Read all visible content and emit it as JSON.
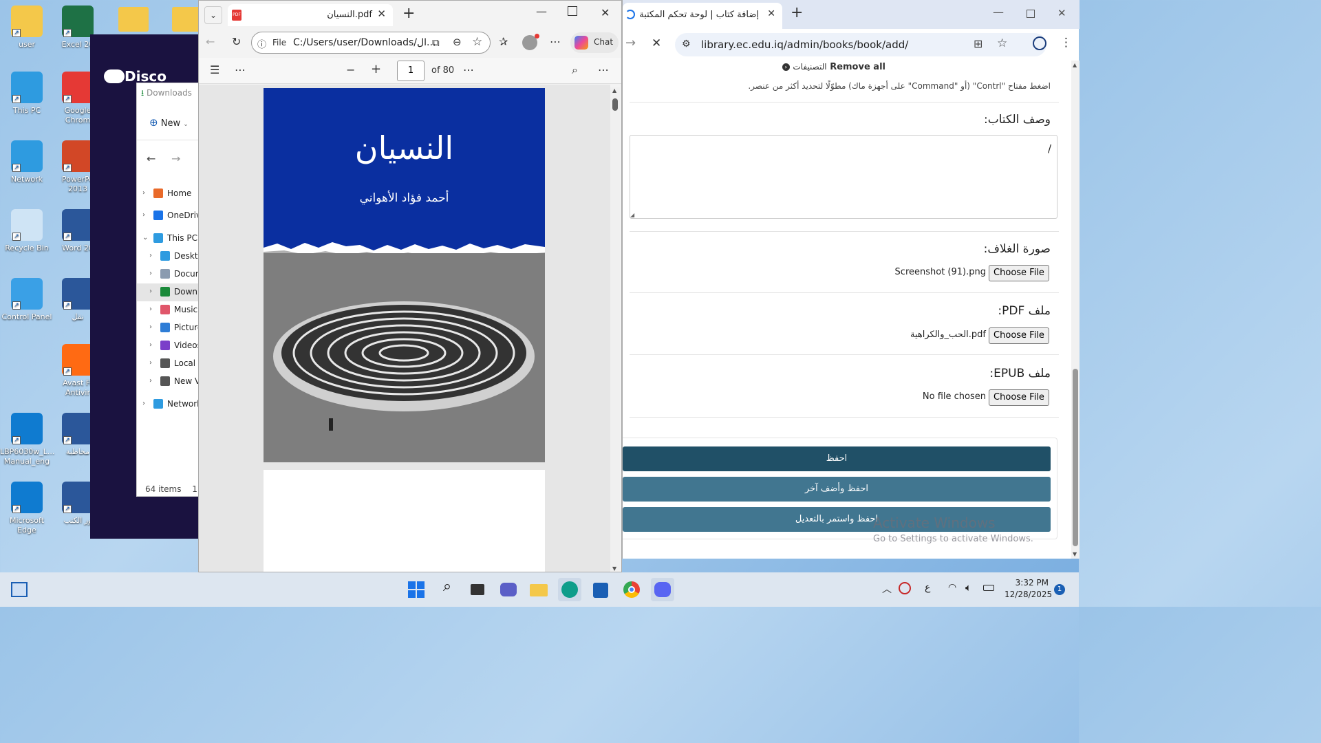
{
  "desktop": {
    "icons_left": [
      {
        "label": "user",
        "color": "#f4c84a"
      },
      {
        "label": "This PC",
        "color": "#2e9be0"
      },
      {
        "label": "Network",
        "color": "#2e9be0"
      },
      {
        "label": "Recycle Bin",
        "color": "#cfe4f5"
      },
      {
        "label": "Control Panel",
        "color": "#3aa0e6"
      },
      {
        "label": "LBP6030w_L...\nManual_eng",
        "color": "#0f7bd0"
      },
      {
        "label": "Microsoft\nEdge",
        "color": "#0f7bd0"
      }
    ],
    "icons_right": [
      {
        "label": "Excel 20",
        "color": "#1e7145"
      },
      {
        "label": "Google\nChrom",
        "color": "#e53935"
      },
      {
        "label": "PowerPo\n2013",
        "color": "#d24726"
      },
      {
        "label": "Word 20",
        "color": "#2b579a"
      },
      {
        "label": "نقل",
        "color": "#2b579a"
      },
      {
        "label": "Avast Fr\nAntivir",
        "color": "#ff6a13"
      },
      {
        "label": "مخاطبة",
        "color": "#2b579a"
      },
      {
        "label": "ور الكتب",
        "color": "#2b579a"
      }
    ],
    "folder_icons": [
      "folder",
      "folder"
    ]
  },
  "discord": {
    "logo_text": "Disco"
  },
  "explorer": {
    "breadcrumb": "Downloads",
    "new_label": "New",
    "nav": [
      {
        "label": "Home",
        "indent": 0,
        "expanded": false,
        "icon_color": "#e96a2a"
      },
      {
        "label": "OneDriv",
        "indent": 0,
        "expanded": false,
        "icon_color": "#1a73e8"
      },
      {
        "label": "This PC",
        "indent": 0,
        "expanded": true,
        "icon_color": "#2e9be0"
      },
      {
        "label": "Deskto",
        "indent": 1,
        "expanded": false,
        "icon_color": "#2e9be0"
      },
      {
        "label": "Docum",
        "indent": 1,
        "expanded": false,
        "icon_color": "#8a9bb0"
      },
      {
        "label": "Downl",
        "indent": 1,
        "expanded": false,
        "icon_color": "#1b8a3a",
        "selected": true
      },
      {
        "label": "Music",
        "indent": 1,
        "expanded": false,
        "icon_color": "#e0566a"
      },
      {
        "label": "Picture",
        "indent": 1,
        "expanded": false,
        "icon_color": "#2e7dd6"
      },
      {
        "label": "Videos",
        "indent": 1,
        "expanded": false,
        "icon_color": "#7b3fc9"
      },
      {
        "label": "Local D",
        "indent": 1,
        "expanded": false,
        "icon_color": "#555"
      },
      {
        "label": "New Vo",
        "indent": 1,
        "expanded": false,
        "icon_color": "#555"
      },
      {
        "label": "Network",
        "indent": 0,
        "expanded": false,
        "icon_color": "#2e9be0"
      }
    ],
    "status": "64 items",
    "status2": "1"
  },
  "pdf": {
    "tab_title": "النسيان.pdf",
    "address_prefix": "File",
    "address": "C:/Users/user/Downloads/ال...",
    "chat_label": "Chat",
    "page_input": "1",
    "page_of": "of 80",
    "cover_title": "النسيان",
    "cover_author": "أحمد فؤاد الأهواني",
    "cover_color": "#0a2fa0"
  },
  "chrome": {
    "tab_title": "إضافة كتاب | لوحة تحكم المكتبة",
    "url": "library.ec.edu.iq/admin/books/book/add/",
    "remove_all": "Remove all",
    "categories_label": "التصنيفات",
    "multi_hint": "اضغط مفتاح \"Contrl\" (أو \"Command\" على أجهزة ماك) مطوّلًا لتحديد أكثر من عنصر.",
    "description_label": "وصف الكتاب:",
    "description_value": "/",
    "cover_label": "صورة الغلاف:",
    "cover_file": "Screenshot (91).png",
    "pdf_label": "ملف PDF:",
    "pdf_file": "الحب_والكراهية.pdf",
    "epub_label": "ملف EPUB:",
    "epub_file": "No file chosen",
    "choose_file": "Choose File",
    "save": "احفظ",
    "save_add": "احفظ وأضف آخر",
    "save_continue": "احفظ واستمر بالتعديل",
    "primary_color": "#205067",
    "secondary_color": "#417690"
  },
  "watermark": {
    "title": "Activate Windows",
    "subtitle": "Go to Settings to activate Windows."
  },
  "taskbar": {
    "time": "3:32 PM",
    "date": "12/28/2025",
    "lang": "ع",
    "notif_count": "1"
  }
}
